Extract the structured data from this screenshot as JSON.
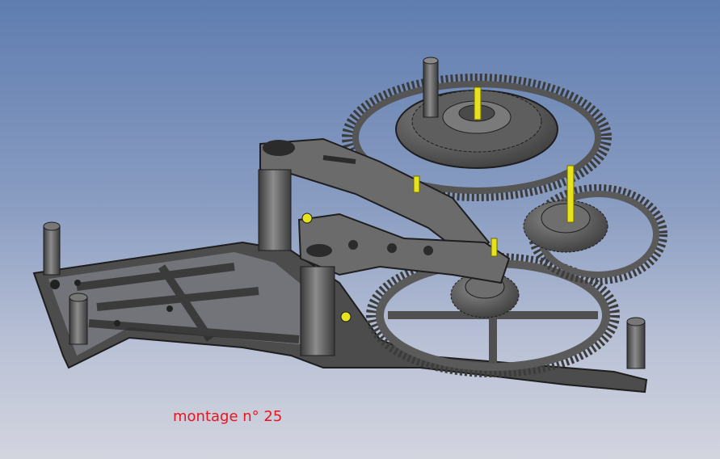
{
  "scene": {
    "caption": "montage n° 25",
    "caption_color": "#e8141e",
    "background_top": "#5f7db0",
    "background_bottom": "#d3d5df",
    "part_color": "#5a5a5a",
    "pin_color": "#e6e21e"
  }
}
